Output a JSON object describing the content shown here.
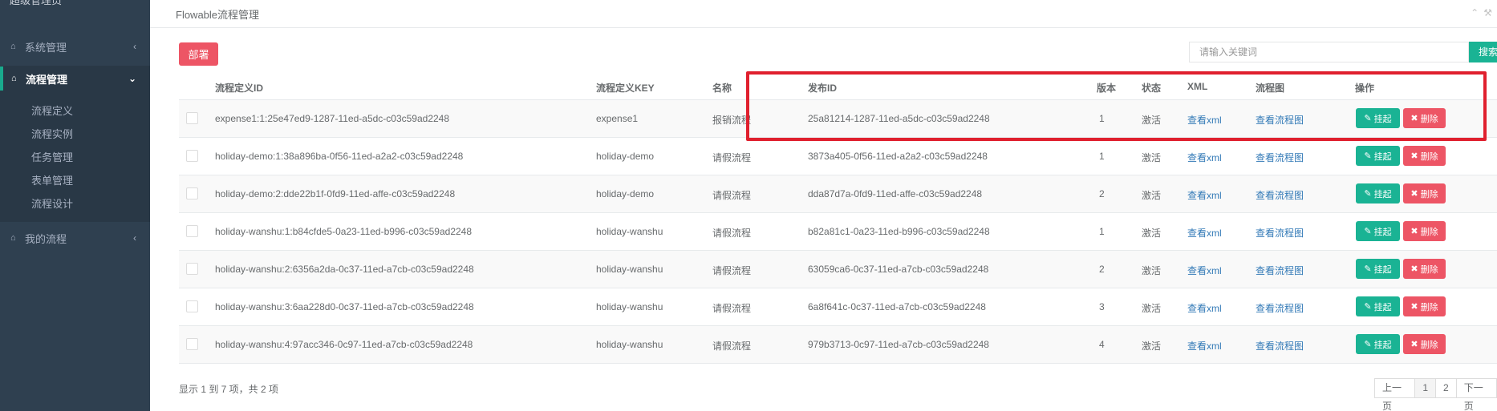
{
  "sidebar": {
    "top_text": "超级管理员",
    "menus": [
      {
        "label": "系统管理",
        "icon": "home-icon"
      },
      {
        "label": "流程管理",
        "icon": "home-icon"
      },
      {
        "label": "我的流程",
        "icon": "home-icon"
      }
    ],
    "submenu": [
      "流程定义",
      "流程实例",
      "任务管理",
      "表单管理",
      "流程设计"
    ]
  },
  "panel": {
    "title": "Flowable流程管理"
  },
  "toolbar": {
    "deploy_label": "部署",
    "search_placeholder": "请输入关键词",
    "search_label": "搜索"
  },
  "table": {
    "headers": [
      "流程定义ID",
      "流程定义KEY",
      "名称",
      "发布ID",
      "版本",
      "状态",
      "XML",
      "流程图",
      "操作"
    ],
    "rows": [
      {
        "id": "expense1:1:25e47ed9-1287-11ed-a5dc-c03c59ad2248",
        "key": "expense1",
        "name": "报销流程",
        "deploy_id": "25a81214-1287-11ed-a5dc-c03c59ad2248",
        "version": "1",
        "status": "激活",
        "xml": "查看xml",
        "diagram": "查看流程图"
      },
      {
        "id": "holiday-demo:1:38a896ba-0f56-11ed-a2a2-c03c59ad2248",
        "key": "holiday-demo",
        "name": "请假流程",
        "deploy_id": "3873a405-0f56-11ed-a2a2-c03c59ad2248",
        "version": "1",
        "status": "激活",
        "xml": "查看xml",
        "diagram": "查看流程图"
      },
      {
        "id": "holiday-demo:2:dde22b1f-0fd9-11ed-affe-c03c59ad2248",
        "key": "holiday-demo",
        "name": "请假流程",
        "deploy_id": "dda87d7a-0fd9-11ed-affe-c03c59ad2248",
        "version": "2",
        "status": "激活",
        "xml": "查看xml",
        "diagram": "查看流程图"
      },
      {
        "id": "holiday-wanshu:1:b84cfde5-0a23-11ed-b996-c03c59ad2248",
        "key": "holiday-wanshu",
        "name": "请假流程",
        "deploy_id": "b82a81c1-0a23-11ed-b996-c03c59ad2248",
        "version": "1",
        "status": "激活",
        "xml": "查看xml",
        "diagram": "查看流程图"
      },
      {
        "id": "holiday-wanshu:2:6356a2da-0c37-11ed-a7cb-c03c59ad2248",
        "key": "holiday-wanshu",
        "name": "请假流程",
        "deploy_id": "63059ca6-0c37-11ed-a7cb-c03c59ad2248",
        "version": "2",
        "status": "激活",
        "xml": "查看xml",
        "diagram": "查看流程图"
      },
      {
        "id": "holiday-wanshu:3:6aa228d0-0c37-11ed-a7cb-c03c59ad2248",
        "key": "holiday-wanshu",
        "name": "请假流程",
        "deploy_id": "6a8f641c-0c37-11ed-a7cb-c03c59ad2248",
        "version": "3",
        "status": "激活",
        "xml": "查看xml",
        "diagram": "查看流程图"
      },
      {
        "id": "holiday-wanshu:4:97acc346-0c97-11ed-a7cb-c03c59ad2248",
        "key": "holiday-wanshu",
        "name": "请假流程",
        "deploy_id": "979b3713-0c97-11ed-a7cb-c03c59ad2248",
        "version": "4",
        "status": "激活",
        "xml": "查看xml",
        "diagram": "查看流程图"
      }
    ],
    "suspend_label": "挂起",
    "delete_label": "删除"
  },
  "footer": {
    "info": "显示 1 到 7 项，共 2 项",
    "pager": [
      "上一页",
      "1",
      "2",
      "下一页"
    ],
    "active_page": "1"
  },
  "colors": {
    "sidebar_bg": "#2f4050",
    "success": "#1ab394",
    "danger": "#ed5565",
    "highlight": "#e0202e",
    "link": "#337ab7"
  }
}
